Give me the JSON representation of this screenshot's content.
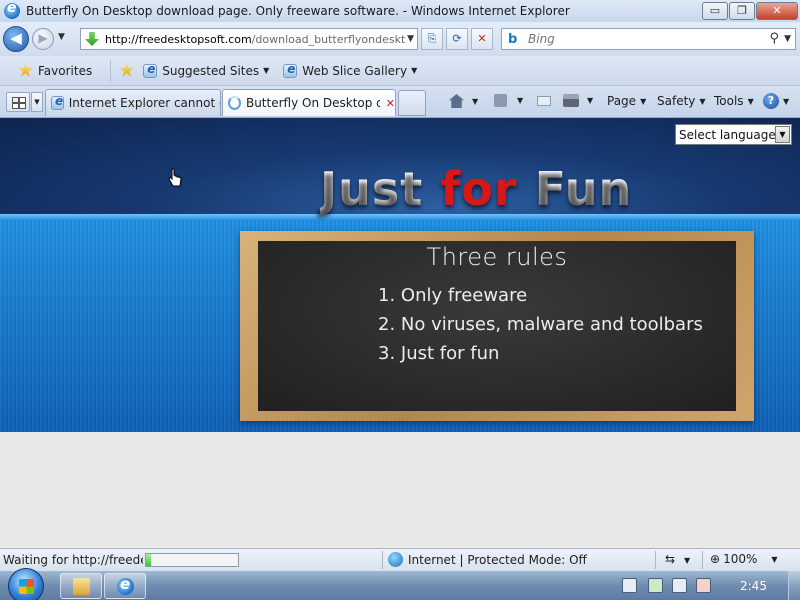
{
  "window": {
    "title": "Butterfly On Desktop download page. Only freeware software. - Windows Internet Explorer",
    "minimize": "▭",
    "restore": "❐",
    "close": "✕"
  },
  "nav": {
    "back": "◀",
    "forward": "▶",
    "address_host": "http://freedesktopsoft.com",
    "address_path": "/download_butterflyondeskt",
    "search_placeholder": "Bing",
    "search_engine_glyph": "b",
    "search_glyph": "⚲"
  },
  "favorites": {
    "favorites_label": "Favorites",
    "suggested_sites": "Suggested Sites",
    "web_slice_gallery": "Web Slice Gallery"
  },
  "tabs": [
    {
      "label": "Internet Explorer cannot d..."
    },
    {
      "label": "Butterfly On Desktop d...",
      "close": "✕"
    }
  ],
  "commands": {
    "page": "Page",
    "safety": "Safety",
    "tools": "Tools",
    "help": "?"
  },
  "content": {
    "language_select": "Select language",
    "headline": {
      "part1": "Just ",
      "part2": "for",
      "part3": " Fun"
    },
    "board_title": "Three rules",
    "rules": [
      "1. Only freeware",
      "2. No viruses, malware and toolbars",
      "3. Just for fun"
    ]
  },
  "status": {
    "text": "Waiting for http://freedesktopsoft.com",
    "progress": 0.05,
    "zone": "Internet | Protected Mode: Off",
    "zoom": "100%"
  },
  "taskbar": {
    "clock": "2:45"
  },
  "colors": {
    "headline_red": "#d81818",
    "banner_blue": "#1f8fe0",
    "progress_green": "#3cc23a"
  }
}
